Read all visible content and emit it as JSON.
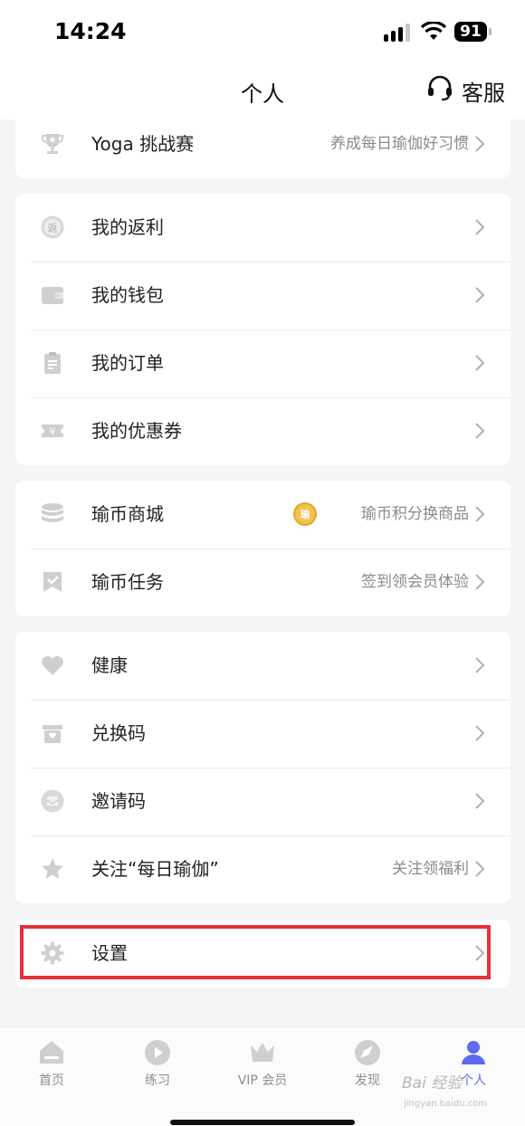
{
  "status": {
    "time": "14:24",
    "battery": "91"
  },
  "nav": {
    "title": "个人",
    "service_label": "客服"
  },
  "cards": [
    {
      "items": [
        {
          "label": "Yoga 挑战赛",
          "sub": "养成每日瑜伽好习惯"
        }
      ]
    },
    {
      "items": [
        {
          "label": "我的返利"
        },
        {
          "label": "我的钱包"
        },
        {
          "label": "我的订单"
        },
        {
          "label": "我的优惠券"
        }
      ]
    },
    {
      "items": [
        {
          "label": "瑜币商城",
          "sub": "瑜币积分换商品"
        },
        {
          "label": "瑜币任务",
          "sub": "签到领会员体验"
        }
      ]
    },
    {
      "items": [
        {
          "label": "健康"
        },
        {
          "label": "兑换码"
        },
        {
          "label": "邀请码"
        },
        {
          "label": "关注“每日瑜伽”",
          "sub": "关注领福利"
        }
      ]
    },
    {
      "items": [
        {
          "label": "设置"
        }
      ]
    }
  ],
  "coin_glyph": "瑜",
  "tabs": [
    {
      "label": "首页",
      "icon": "home-icon"
    },
    {
      "label": "练习",
      "icon": "play-icon"
    },
    {
      "label": "VIP 会员",
      "icon": "crown-icon"
    },
    {
      "label": "发现",
      "icon": "compass-icon"
    },
    {
      "label": "个人",
      "icon": "person-icon",
      "active": true
    }
  ],
  "watermark": {
    "main": "Bai 经验",
    "sub": "jingyan.baidu.com"
  },
  "colors": {
    "accent": "#5b6cf0",
    "highlight": "#e8303a",
    "icon_gray": "#cfcfcf"
  }
}
